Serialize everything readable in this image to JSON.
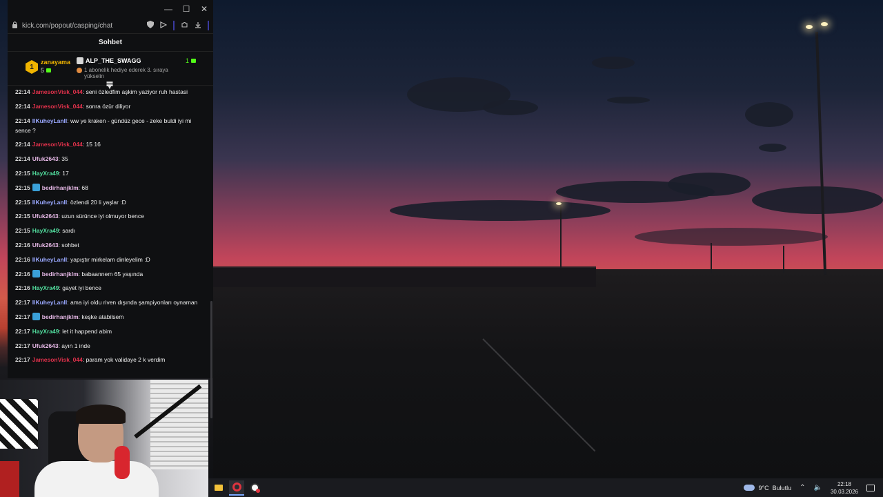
{
  "window": {
    "minimize_label": "—",
    "maximize_label": "☐",
    "close_label": "✕"
  },
  "address_bar": {
    "url": "kick.com/popout/casping/chat"
  },
  "chat": {
    "title": "Sohbet",
    "pinned": {
      "top_rank": "1",
      "top_user": "zanayama",
      "top_count": "5",
      "gift_user": "ALP_THE_SWAGG",
      "gift_count": "1",
      "gift_desc": "1 abonelik hediye ederek 3. sıraya yükselin"
    },
    "messages": [
      {
        "time": "22:14",
        "user": "JamesonVisk_044",
        "color": "#e0314b",
        "badge": false,
        "text": ": seni özledfim aşkim yaziyor ruh hastasi"
      },
      {
        "time": "22:14",
        "user": "JamesonVisk_044",
        "color": "#e0314b",
        "badge": false,
        "text": ": sonra özür diliyor"
      },
      {
        "time": "22:14",
        "user": "IlKuheyLanIl",
        "color": "#9aa8ff",
        "badge": false,
        "text": ": ww ye kraken - gündüz gece - zeke buldi iyi mi sence ?"
      },
      {
        "time": "22:14",
        "user": "JamesonVisk_044",
        "color": "#e0314b",
        "badge": false,
        "text": ": 15 16"
      },
      {
        "time": "22:14",
        "user": "Ufuk2643",
        "color": "#e6b8e6",
        "badge": false,
        "text": ": 35"
      },
      {
        "time": "22:15",
        "user": "HayXra49",
        "color": "#53e0a0",
        "badge": false,
        "text": ": 17"
      },
      {
        "time": "22:15",
        "user": "bedirhanjklm",
        "color": "#e6b8e6",
        "badge": true,
        "text": ": 68"
      },
      {
        "time": "22:15",
        "user": "IlKuheyLanIl",
        "color": "#9aa8ff",
        "badge": false,
        "text": ": özlendi 20 li yaşlar :D"
      },
      {
        "time": "22:15",
        "user": "Ufuk2643",
        "color": "#e6b8e6",
        "badge": false,
        "text": ": uzun sürünce iyi olmuyor bence"
      },
      {
        "time": "22:15",
        "user": "HayXra49",
        "color": "#53e0a0",
        "badge": false,
        "text": ": sardı"
      },
      {
        "time": "22:16",
        "user": "Ufuk2643",
        "color": "#e6b8e6",
        "badge": false,
        "text": ": sohbet"
      },
      {
        "time": "22:16",
        "user": "IlKuheyLanIl",
        "color": "#9aa8ff",
        "badge": false,
        "text": ": yapıştır mirkelam dinleyelim :D"
      },
      {
        "time": "22:16",
        "user": "bedirhanjklm",
        "color": "#e6b8e6",
        "badge": true,
        "text": ": babaannem 65 yaşında"
      },
      {
        "time": "22:16",
        "user": "HayXra49",
        "color": "#53e0a0",
        "badge": false,
        "text": ": gayet iyi bence"
      },
      {
        "time": "22:17",
        "user": "IlKuheyLanIl",
        "color": "#9aa8ff",
        "badge": false,
        "text": ": ama iyi oldu riven dışında şampiyonları oynaman"
      },
      {
        "time": "22:17",
        "user": "bedirhanjklm",
        "color": "#e6b8e6",
        "badge": true,
        "text": ": keşke atabilsem"
      },
      {
        "time": "22:17",
        "user": "HayXra49",
        "color": "#53e0a0",
        "badge": false,
        "text": ": let it happend abim"
      },
      {
        "time": "22:17",
        "user": "Ufuk2643",
        "color": "#e6b8e6",
        "badge": false,
        "text": ": ayın 1 inde"
      },
      {
        "time": "22:17",
        "user": "JamesonVisk_044",
        "color": "#e0314b",
        "badge": false,
        "text": ": param yok validaye 2 k verdim"
      }
    ]
  },
  "taskbar": {
    "weather_temp": "9°C",
    "weather_desc": "Bulutlu",
    "time": "22:18",
    "date": "30.03.2026"
  },
  "colors": {
    "kick_green": "#53fc18",
    "gold": "#f0b400"
  }
}
